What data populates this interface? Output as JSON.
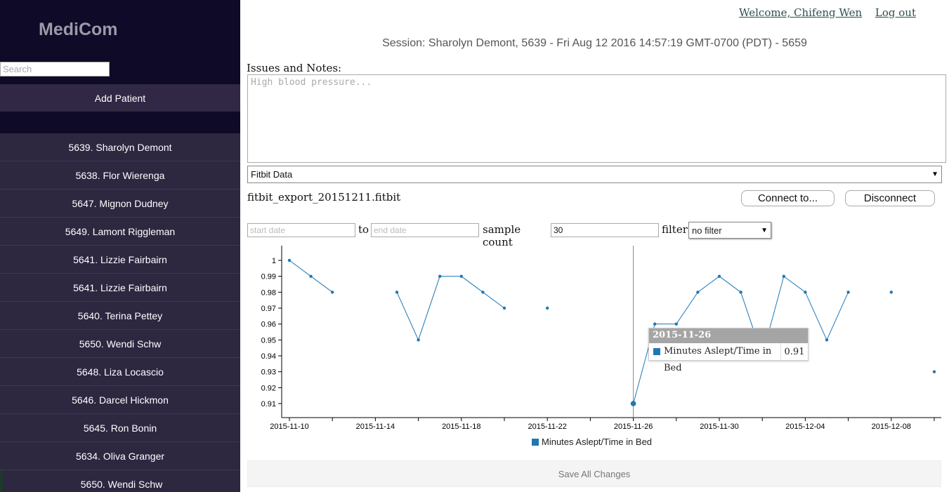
{
  "sidebar": {
    "app_name": "MediCom",
    "search_placeholder": "Search",
    "add_patient_label": "Add Patient",
    "patients": [
      "5639. Sharolyn Demont",
      "5638. Flor Wierenga",
      "5647. Mignon Dudney",
      "5649. Lamont Riggleman",
      "5641. Lizzie Fairbairn",
      "5641. Lizzie Fairbairn",
      "5640. Terina Pettey",
      "5650. Wendi Schw",
      "5648. Liza Locascio",
      "5646. Darcel Hickmon",
      "5645. Ron Bonin",
      "5634. Oliva Granger",
      "5650. Wendi Schw"
    ]
  },
  "header": {
    "welcome": "Welcome, Chifeng Wen",
    "logout": "Log out",
    "session": "Session: Sharolyn Demont, 5639 - Fri Aug 12 2016 14:57:19 GMT-0700 (PDT) - 5659"
  },
  "notes": {
    "label": "Issues and Notes:",
    "placeholder": "High blood pressure..."
  },
  "data_source": {
    "selected": "Fitbit Data",
    "file_name": "fitbit_export_20151211.fitbit",
    "connect_label": "Connect to...",
    "disconnect_label": "Disconnect"
  },
  "filters": {
    "start_placeholder": "start date",
    "to_label": "to",
    "end_placeholder": "end date",
    "sample_count_label": "sample count",
    "sample_count_value": "30",
    "filter_label": "filter",
    "filter_selected": "no filter"
  },
  "tooltip": {
    "date": "2015-11-26",
    "series": "Minutes Aslept/Time in Bed",
    "value": "0.91"
  },
  "save_label": "Save All Changes",
  "colors": {
    "sidebar_bg": "#0f0a28",
    "sidebar_item_bg": "#2d2740",
    "series": "#1f77b4"
  },
  "chart_data": {
    "type": "line",
    "xlabel": "",
    "ylabel": "",
    "ylim": [
      0.9,
      1.01
    ],
    "y_ticks": [
      0.91,
      0.92,
      0.93,
      0.94,
      0.95,
      0.96,
      0.97,
      0.98,
      0.99,
      1
    ],
    "y_tick_labels": [
      "0.91",
      "0.92",
      "0.93",
      "0.94",
      "0.95",
      "0.96",
      "0.97",
      "0.98",
      "0.99",
      "1"
    ],
    "x_tick_labels": [
      "2015-11-10",
      "2015-11-14",
      "2015-11-18",
      "2015-11-22",
      "2015-11-26",
      "2015-11-30",
      "2015-12-04",
      "2015-12-08"
    ],
    "legend": "bottom",
    "series": [
      {
        "name": "Minutes Aslept/Time in Bed",
        "points": [
          {
            "date": "2015-11-10",
            "value": 1.0
          },
          {
            "date": "2015-11-11",
            "value": 0.99
          },
          {
            "date": "2015-11-12",
            "value": 0.98
          },
          {
            "date": "2015-11-13",
            "value": null
          },
          {
            "date": "2015-11-14",
            "value": null
          },
          {
            "date": "2015-11-15",
            "value": 0.98
          },
          {
            "date": "2015-11-16",
            "value": 0.95
          },
          {
            "date": "2015-11-17",
            "value": 0.99
          },
          {
            "date": "2015-11-18",
            "value": 0.99
          },
          {
            "date": "2015-11-19",
            "value": 0.98
          },
          {
            "date": "2015-11-20",
            "value": 0.97
          },
          {
            "date": "2015-11-21",
            "value": null
          },
          {
            "date": "2015-11-22",
            "value": 0.97
          },
          {
            "date": "2015-11-23",
            "value": null
          },
          {
            "date": "2015-11-24",
            "value": null
          },
          {
            "date": "2015-11-25",
            "value": null
          },
          {
            "date": "2015-11-26",
            "value": 0.91
          },
          {
            "date": "2015-11-27",
            "value": 0.96
          },
          {
            "date": "2015-11-28",
            "value": 0.96
          },
          {
            "date": "2015-11-29",
            "value": 0.98
          },
          {
            "date": "2015-11-30",
            "value": 0.99
          },
          {
            "date": "2015-12-01",
            "value": 0.98
          },
          {
            "date": "2015-12-02",
            "value": 0.94
          },
          {
            "date": "2015-12-03",
            "value": 0.99
          },
          {
            "date": "2015-12-04",
            "value": 0.98
          },
          {
            "date": "2015-12-05",
            "value": 0.95
          },
          {
            "date": "2015-12-06",
            "value": 0.98
          },
          {
            "date": "2015-12-07",
            "value": null
          },
          {
            "date": "2015-12-08",
            "value": 0.98
          },
          {
            "date": "2015-12-09",
            "value": null
          },
          {
            "date": "2015-12-10",
            "value": 0.93
          }
        ]
      }
    ],
    "highlighted_date": "2015-11-26"
  }
}
